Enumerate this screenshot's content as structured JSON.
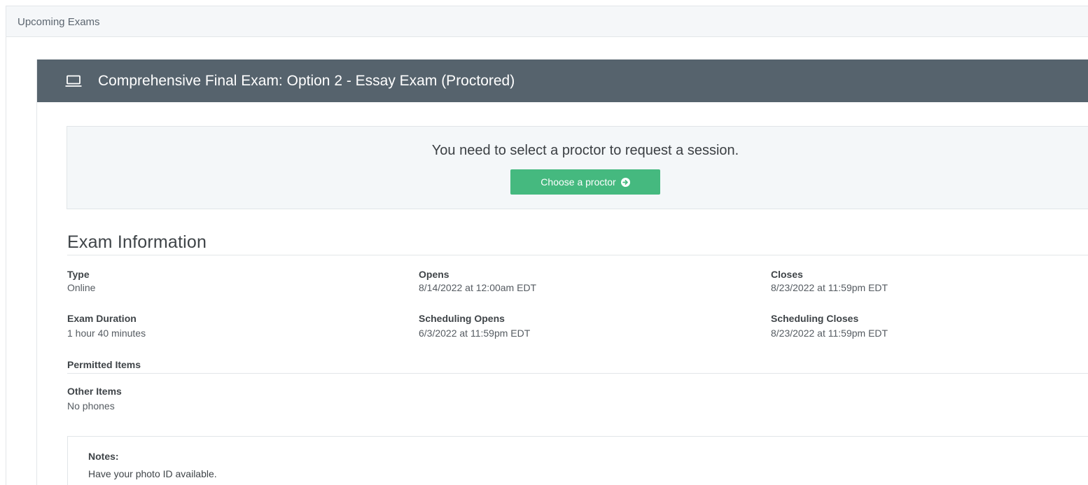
{
  "top_bar": {
    "title": "Upcoming Exams"
  },
  "exam": {
    "icon": "laptop-icon",
    "title": "Comprehensive Final Exam: Option 2 - Essay Exam (Proctored)",
    "header_color": "#56636d"
  },
  "notice": {
    "message": "You need to select a proctor to request a session.",
    "button_label": "Choose a proctor",
    "button_icon": "arrow-circle-right-icon",
    "button_color": "#45b97f"
  },
  "exam_information": {
    "heading": "Exam Information",
    "fields": {
      "type": {
        "label": "Type",
        "value": "Online"
      },
      "opens": {
        "label": "Opens",
        "value": "8/14/2022 at 12:00am EDT"
      },
      "closes": {
        "label": "Closes",
        "value": "8/23/2022 at 11:59pm EDT"
      },
      "duration": {
        "label": "Exam Duration",
        "value": "1 hour 40 minutes"
      },
      "scheduling_opens": {
        "label": "Scheduling Opens",
        "value": "6/3/2022 at 11:59pm EDT"
      },
      "scheduling_closes": {
        "label": "Scheduling Closes",
        "value": "8/23/2022 at 11:59pm EDT"
      }
    },
    "permitted_items": {
      "label": "Permitted Items"
    },
    "other_items": {
      "label": "Other Items",
      "value": "No phones"
    }
  },
  "notes": {
    "label": "Notes:",
    "text": "Have your photo ID available."
  }
}
